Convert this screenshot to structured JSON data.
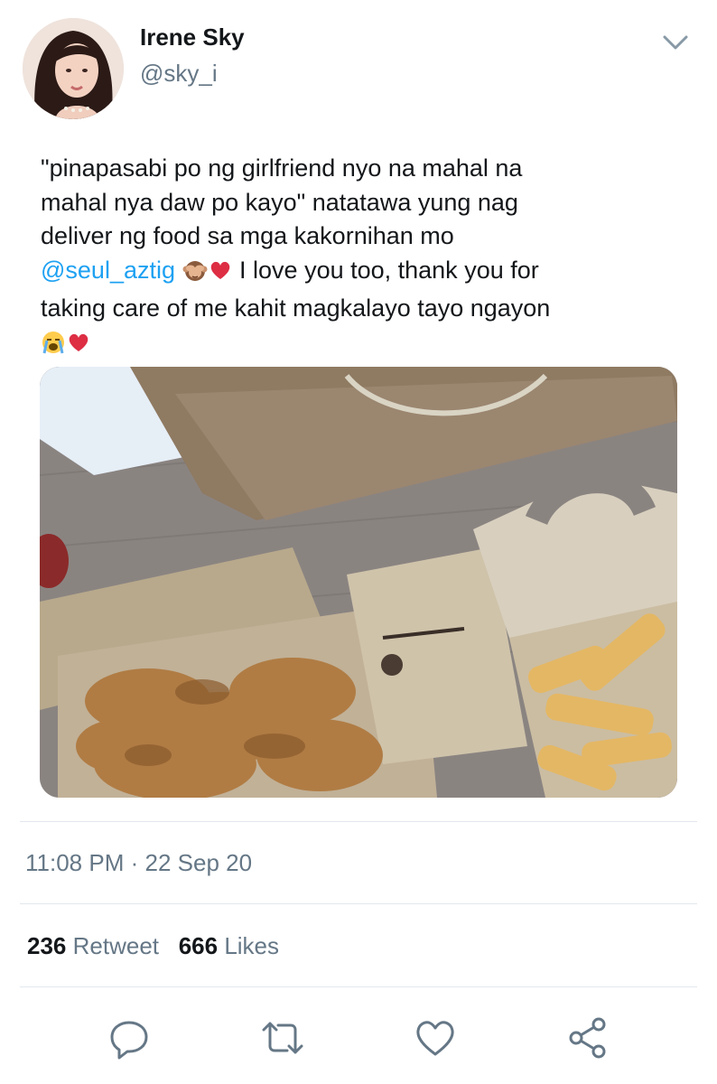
{
  "user": {
    "display_name": "Irene Sky",
    "handle": "@sky_i"
  },
  "tweet": {
    "line1": "\"pinapasabi po ng girlfriend nyo na mahal na",
    "line2": "mahal nya daw po kayo\" natatawa yung nag",
    "line3": "deliver ng food sa mga kakornihan mo",
    "mention": "@seul_aztig",
    "line4_rest": "I love you too, thank you for",
    "line5": "taking care of me kahit magkalayo tayo ngayon",
    "emojis_line4": [
      "see-no-evil-monkey",
      "red-heart"
    ],
    "emojis_line6": [
      "loudly-crying-face",
      "red-heart"
    ]
  },
  "timestamp": {
    "time": "11:08 PM",
    "separator": "·",
    "date": "22 Sep 20"
  },
  "stats": {
    "retweets_count": "236",
    "retweets_label": "Retweet",
    "likes_count": "666",
    "likes_label": "Likes"
  },
  "actions": [
    "reply-icon",
    "retweet-icon",
    "like-icon",
    "share-icon"
  ],
  "colors": {
    "link": "#1da1f2",
    "secondary_text": "#657786",
    "primary_text": "#14171a",
    "divider": "#e1e8ed"
  }
}
